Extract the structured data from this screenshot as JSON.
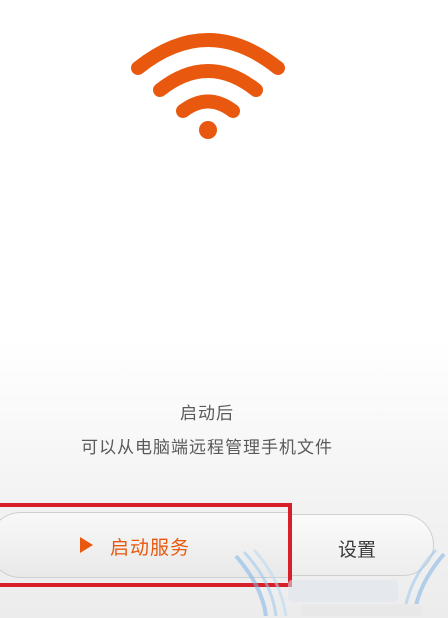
{
  "description": {
    "line1": "启动后",
    "line2": "可以从电脑端远程管理手机文件"
  },
  "buttons": {
    "start_label": "启动服务",
    "settings_label": "设置"
  },
  "icons": {
    "wifi": "wifi-icon",
    "play": "play-icon"
  },
  "colors": {
    "accent": "#e8590f",
    "highlight_frame": "#d8202a",
    "text": "#5a5a5a"
  }
}
